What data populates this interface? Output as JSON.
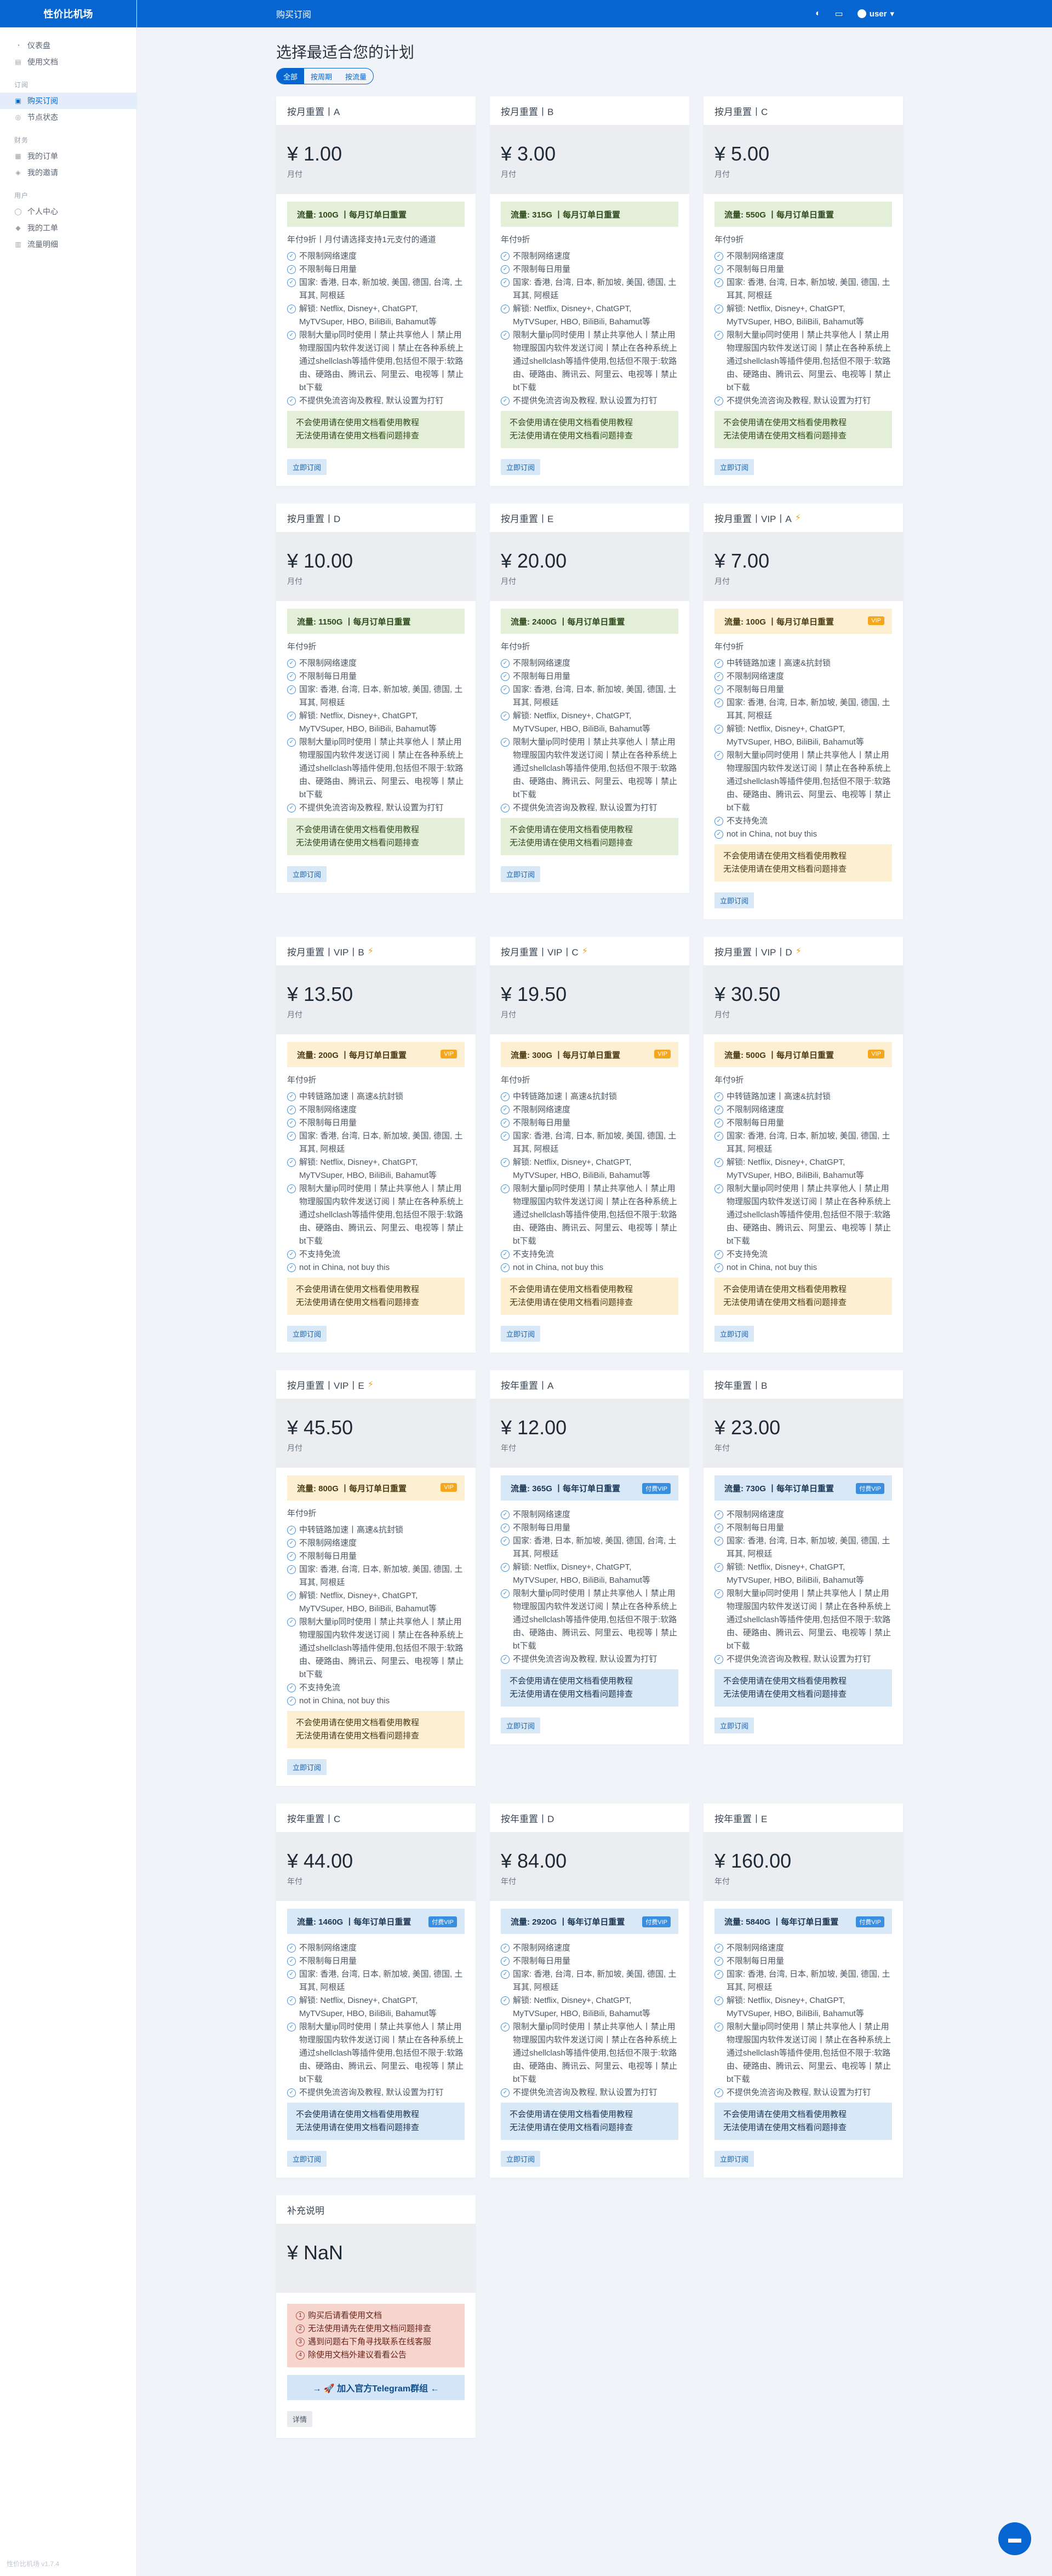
{
  "brand": "性价比机场",
  "sidebar": {
    "groups": [
      {
        "heading": "",
        "items": [
          {
            "icon": "dashboard-icon",
            "glyph": "◔",
            "label": "仪表盘"
          },
          {
            "icon": "docs-icon",
            "glyph": "▤",
            "label": "使用文档"
          }
        ]
      },
      {
        "heading": "订阅",
        "items": [
          {
            "icon": "cart-icon",
            "glyph": "▣",
            "label": "购买订阅",
            "active": true
          },
          {
            "icon": "node-icon",
            "glyph": "◎",
            "label": "节点状态"
          }
        ]
      },
      {
        "heading": "财务",
        "items": [
          {
            "icon": "order-icon",
            "glyph": "▦",
            "label": "我的订单"
          },
          {
            "icon": "invite-icon",
            "glyph": "◈",
            "label": "我的邀请"
          }
        ]
      },
      {
        "heading": "用户",
        "items": [
          {
            "icon": "user-icon",
            "glyph": "◯",
            "label": "个人中心"
          },
          {
            "icon": "ticket-icon",
            "glyph": "◆",
            "label": "我的工单"
          },
          {
            "icon": "traffic-icon",
            "glyph": "▥",
            "label": "流量明细"
          }
        ]
      }
    ],
    "footer": "性价比机场 v1.7.4"
  },
  "topbar": {
    "title": "购买订阅",
    "user": "user"
  },
  "page": {
    "title": "选择最适合您的计划",
    "tabs": [
      {
        "label": "全部",
        "active": true
      },
      {
        "label": "按周期",
        "active": false
      },
      {
        "label": "按流量",
        "active": false
      }
    ]
  },
  "labels": {
    "buy": "立即订阅",
    "vip_badge": "VIP",
    "year_badge": "付费VIP",
    "tg_button": "→ 🚀 加入官方Telegram群组 ←",
    "details_btn": "详情"
  },
  "plans": [
    {
      "title": "按月重置丨A",
      "price": "¥ 1.00",
      "period": "月付",
      "tone": "green",
      "banner": "流量: 100G 丨每月订单日重置",
      "badge": "",
      "bolt": false,
      "note": "年付9折丨月付请选择支持1元支付的通道",
      "features": [
        "不限制网络速度",
        "不限制每日用量",
        "国家: 香港, 日本, 新加坡, 美国, 德国, 台湾, 土耳其, 阿根廷",
        "解锁: Netflix, Disney+, ChatGPT, MyTVSuper, HBO, BiliBili, Bahamut等",
        "限制大量ip同时使用丨禁止共享他人丨禁止用物理服国内软件发送订阅丨禁止在各种系统上通过shellclash等插件使用,包括但不限于:软路由、硬路由、腾讯云、阿里云、电视等丨禁止bt下载",
        "不提供免流咨询及教程, 默认设置为打钉"
      ],
      "alert": [
        "不会使用请在使用文档看使用教程",
        "无法使用请在使用文档看问题排查"
      ]
    },
    {
      "title": "按月重置丨B",
      "price": "¥ 3.00",
      "period": "月付",
      "tone": "green",
      "banner": "流量: 315G 丨每月订单日重置",
      "badge": "",
      "bolt": false,
      "note": "年付9折",
      "features": [
        "不限制网络速度",
        "不限制每日用量",
        "国家: 香港, 台湾, 日本, 新加坡, 美国, 德国, 土耳其, 阿根廷",
        "解锁: Netflix, Disney+, ChatGPT, MyTVSuper, HBO, BiliBili, Bahamut等",
        "限制大量ip同时使用丨禁止共享他人丨禁止用物理服国内软件发送订阅丨禁止在各种系统上通过shellclash等插件使用,包括但不限于:软路由、硬路由、腾讯云、阿里云、电视等丨禁止bt下载",
        "不提供免流咨询及教程, 默认设置为打钉"
      ],
      "alert": [
        "不会使用请在使用文档看使用教程",
        "无法使用请在使用文档看问题排查"
      ]
    },
    {
      "title": "按月重置丨C",
      "price": "¥ 5.00",
      "period": "月付",
      "tone": "green",
      "banner": "流量: 550G 丨每月订单日重置",
      "badge": "",
      "bolt": false,
      "note": "年付9折",
      "features": [
        "不限制网络速度",
        "不限制每日用量",
        "国家: 香港, 台湾, 日本, 新加坡, 美国, 德国, 土耳其, 阿根廷",
        "解锁: Netflix, Disney+, ChatGPT, MyTVSuper, HBO, BiliBili, Bahamut等",
        "限制大量ip同时使用丨禁止共享他人丨禁止用物理服国内软件发送订阅丨禁止在各种系统上通过shellclash等插件使用,包括但不限于:软路由、硬路由、腾讯云、阿里云、电视等丨禁止bt下载",
        "不提供免流咨询及教程, 默认设置为打钉"
      ],
      "alert": [
        "不会使用请在使用文档看使用教程",
        "无法使用请在使用文档看问题排查"
      ]
    },
    {
      "title": "按月重置丨D",
      "price": "¥ 10.00",
      "period": "月付",
      "tone": "green",
      "banner": "流量: 1150G 丨每月订单日重置",
      "badge": "",
      "bolt": false,
      "note": "年付9折",
      "features": [
        "不限制网络速度",
        "不限制每日用量",
        "国家: 香港, 台湾, 日本, 新加坡, 美国, 德国, 土耳其, 阿根廷",
        "解锁: Netflix, Disney+, ChatGPT, MyTVSuper, HBO, BiliBili, Bahamut等",
        "限制大量ip同时使用丨禁止共享他人丨禁止用物理服国内软件发送订阅丨禁止在各种系统上通过shellclash等插件使用,包括但不限于:软路由、硬路由、腾讯云、阿里云、电视等丨禁止bt下载",
        "不提供免流咨询及教程, 默认设置为打钉"
      ],
      "alert": [
        "不会使用请在使用文档看使用教程",
        "无法使用请在使用文档看问题排查"
      ]
    },
    {
      "title": "按月重置丨E",
      "price": "¥ 20.00",
      "period": "月付",
      "tone": "green",
      "banner": "流量: 2400G 丨每月订单日重置",
      "badge": "",
      "bolt": false,
      "note": "年付9折",
      "features": [
        "不限制网络速度",
        "不限制每日用量",
        "国家: 香港, 台湾, 日本, 新加坡, 美国, 德国, 土耳其, 阿根廷",
        "解锁: Netflix, Disney+, ChatGPT, MyTVSuper, HBO, BiliBili, Bahamut等",
        "限制大量ip同时使用丨禁止共享他人丨禁止用物理服国内软件发送订阅丨禁止在各种系统上通过shellclash等插件使用,包括但不限于:软路由、硬路由、腾讯云、阿里云、电视等丨禁止bt下载",
        "不提供免流咨询及教程, 默认设置为打钉"
      ],
      "alert": [
        "不会使用请在使用文档看使用教程",
        "无法使用请在使用文档看问题排查"
      ]
    },
    {
      "title": "按月重置丨VIP丨A",
      "price": "¥ 7.00",
      "period": "月付",
      "tone": "yellow",
      "banner": "流量: 100G 丨每月订单日重置",
      "badge": "vip",
      "bolt": true,
      "note": "年付9折",
      "features": [
        "中转链路加速丨高速&抗封锁",
        "不限制网络速度",
        "不限制每日用量",
        "国家: 香港, 台湾, 日本, 新加坡, 美国, 德国, 土耳其, 阿根廷",
        "解锁: Netflix, Disney+, ChatGPT, MyTVSuper, HBO, BiliBili, Bahamut等",
        "限制大量ip同时使用丨禁止共享他人丨禁止用物理服国内软件发送订阅丨禁止在各种系统上通过shellclash等插件使用,包括但不限于:软路由、硬路由、腾讯云、阿里云、电视等丨禁止bt下载",
        "不支持免流",
        "not in China, not buy this"
      ],
      "alert": [
        "不会使用请在使用文档看使用教程",
        "无法使用请在使用文档看问题排查"
      ]
    },
    {
      "title": "按月重置丨VIP丨B",
      "price": "¥ 13.50",
      "period": "月付",
      "tone": "yellow",
      "banner": "流量: 200G 丨每月订单日重置",
      "badge": "vip",
      "bolt": true,
      "note": "年付9折",
      "features": [
        "中转链路加速丨高速&抗封锁",
        "不限制网络速度",
        "不限制每日用量",
        "国家: 香港, 台湾, 日本, 新加坡, 美国, 德国, 土耳其, 阿根廷",
        "解锁: Netflix, Disney+, ChatGPT, MyTVSuper, HBO, BiliBili, Bahamut等",
        "限制大量ip同时使用丨禁止共享他人丨禁止用物理服国内软件发送订阅丨禁止在各种系统上通过shellclash等插件使用,包括但不限于:软路由、硬路由、腾讯云、阿里云、电视等丨禁止bt下载",
        "不支持免流",
        "not in China, not buy this"
      ],
      "alert": [
        "不会使用请在使用文档看使用教程",
        "无法使用请在使用文档看问题排查"
      ]
    },
    {
      "title": "按月重置丨VIP丨C",
      "price": "¥ 19.50",
      "period": "月付",
      "tone": "yellow",
      "banner": "流量: 300G 丨每月订单日重置",
      "badge": "vip",
      "bolt": true,
      "note": "年付9折",
      "features": [
        "中转链路加速丨高速&抗封锁",
        "不限制网络速度",
        "不限制每日用量",
        "国家: 香港, 台湾, 日本, 新加坡, 美国, 德国, 土耳其, 阿根廷",
        "解锁: Netflix, Disney+, ChatGPT, MyTVSuper, HBO, BiliBili, Bahamut等",
        "限制大量ip同时使用丨禁止共享他人丨禁止用物理服国内软件发送订阅丨禁止在各种系统上通过shellclash等插件使用,包括但不限于:软路由、硬路由、腾讯云、阿里云、电视等丨禁止bt下载",
        "不支持免流",
        "not in China, not buy this"
      ],
      "alert": [
        "不会使用请在使用文档看使用教程",
        "无法使用请在使用文档看问题排查"
      ]
    },
    {
      "title": "按月重置丨VIP丨D",
      "price": "¥ 30.50",
      "period": "月付",
      "tone": "yellow",
      "banner": "流量: 500G 丨每月订单日重置",
      "badge": "vip",
      "bolt": true,
      "note": "年付9折",
      "features": [
        "中转链路加速丨高速&抗封锁",
        "不限制网络速度",
        "不限制每日用量",
        "国家: 香港, 台湾, 日本, 新加坡, 美国, 德国, 土耳其, 阿根廷",
        "解锁: Netflix, Disney+, ChatGPT, MyTVSuper, HBO, BiliBili, Bahamut等",
        "限制大量ip同时使用丨禁止共享他人丨禁止用物理服国内软件发送订阅丨禁止在各种系统上通过shellclash等插件使用,包括但不限于:软路由、硬路由、腾讯云、阿里云、电视等丨禁止bt下载",
        "不支持免流",
        "not in China, not buy this"
      ],
      "alert": [
        "不会使用请在使用文档看使用教程",
        "无法使用请在使用文档看问题排查"
      ]
    },
    {
      "title": "按月重置丨VIP丨E",
      "price": "¥ 45.50",
      "period": "月付",
      "tone": "yellow",
      "banner": "流量: 800G 丨每月订单日重置",
      "badge": "vip",
      "bolt": true,
      "note": "年付9折",
      "features": [
        "中转链路加速丨高速&抗封锁",
        "不限制网络速度",
        "不限制每日用量",
        "国家: 香港, 台湾, 日本, 新加坡, 美国, 德国, 土耳其, 阿根廷",
        "解锁: Netflix, Disney+, ChatGPT, MyTVSuper, HBO, BiliBili, Bahamut等",
        "限制大量ip同时使用丨禁止共享他人丨禁止用物理服国内软件发送订阅丨禁止在各种系统上通过shellclash等插件使用,包括但不限于:软路由、硬路由、腾讯云、阿里云、电视等丨禁止bt下载",
        "不支持免流",
        "not in China, not buy this"
      ],
      "alert": [
        "不会使用请在使用文档看使用教程",
        "无法使用请在使用文档看问题排查"
      ]
    },
    {
      "title": "按年重置丨A",
      "price": "¥ 12.00",
      "period": "年付",
      "tone": "blue",
      "banner": "流量: 365G 丨每年订单日重置",
      "badge": "year",
      "bolt": false,
      "note": "",
      "features": [
        "不限制网络速度",
        "不限制每日用量",
        "国家: 香港, 日本, 新加坡, 美国, 德国, 台湾, 土耳其, 阿根廷",
        "解锁: Netflix, Disney+, ChatGPT, MyTVSuper, HBO, BiliBili, Bahamut等",
        "限制大量ip同时使用丨禁止共享他人丨禁止用物理服国内软件发送订阅丨禁止在各种系统上通过shellclash等插件使用,包括但不限于:软路由、硬路由、腾讯云、阿里云、电视等丨禁止bt下载",
        "不提供免流咨询及教程, 默认设置为打钉"
      ],
      "alert": [
        "不会使用请在使用文档看使用教程",
        "无法使用请在使用文档看问题排查"
      ]
    },
    {
      "title": "按年重置丨B",
      "price": "¥ 23.00",
      "period": "年付",
      "tone": "blue",
      "banner": "流量: 730G 丨每年订单日重置",
      "badge": "year",
      "bolt": false,
      "note": "",
      "features": [
        "不限制网络速度",
        "不限制每日用量",
        "国家: 香港, 台湾, 日本, 新加坡, 美国, 德国, 土耳其, 阿根廷",
        "解锁: Netflix, Disney+, ChatGPT, MyTVSuper, HBO, BiliBili, Bahamut等",
        "限制大量ip同时使用丨禁止共享他人丨禁止用物理服国内软件发送订阅丨禁止在各种系统上通过shellclash等插件使用,包括但不限于:软路由、硬路由、腾讯云、阿里云、电视等丨禁止bt下载",
        "不提供免流咨询及教程, 默认设置为打钉"
      ],
      "alert": [
        "不会使用请在使用文档看使用教程",
        "无法使用请在使用文档看问题排查"
      ]
    },
    {
      "title": "按年重置丨C",
      "price": "¥ 44.00",
      "period": "年付",
      "tone": "blue",
      "banner": "流量: 1460G 丨每年订单日重置",
      "badge": "year",
      "bolt": false,
      "note": "",
      "features": [
        "不限制网络速度",
        "不限制每日用量",
        "国家: 香港, 台湾, 日本, 新加坡, 美国, 德国, 土耳其, 阿根廷",
        "解锁: Netflix, Disney+, ChatGPT, MyTVSuper, HBO, BiliBili, Bahamut等",
        "限制大量ip同时使用丨禁止共享他人丨禁止用物理服国内软件发送订阅丨禁止在各种系统上通过shellclash等插件使用,包括但不限于:软路由、硬路由、腾讯云、阿里云、电视等丨禁止bt下载",
        "不提供免流咨询及教程, 默认设置为打钉"
      ],
      "alert": [
        "不会使用请在使用文档看使用教程",
        "无法使用请在使用文档看问题排查"
      ]
    },
    {
      "title": "按年重置丨D",
      "price": "¥ 84.00",
      "period": "年付",
      "tone": "blue",
      "banner": "流量: 2920G 丨每年订单日重置",
      "badge": "year",
      "bolt": false,
      "note": "",
      "features": [
        "不限制网络速度",
        "不限制每日用量",
        "国家: 香港, 台湾, 日本, 新加坡, 美国, 德国, 土耳其, 阿根廷",
        "解锁: Netflix, Disney+, ChatGPT, MyTVSuper, HBO, BiliBili, Bahamut等",
        "限制大量ip同时使用丨禁止共享他人丨禁止用物理服国内软件发送订阅丨禁止在各种系统上通过shellclash等插件使用,包括但不限于:软路由、硬路由、腾讯云、阿里云、电视等丨禁止bt下载",
        "不提供免流咨询及教程, 默认设置为打钉"
      ],
      "alert": [
        "不会使用请在使用文档看使用教程",
        "无法使用请在使用文档看问题排查"
      ]
    },
    {
      "title": "按年重置丨E",
      "price": "¥ 160.00",
      "period": "年付",
      "tone": "blue",
      "banner": "流量: 5840G 丨每年订单日重置",
      "badge": "year",
      "bolt": false,
      "note": "",
      "features": [
        "不限制网络速度",
        "不限制每日用量",
        "国家: 香港, 台湾, 日本, 新加坡, 美国, 德国, 土耳其, 阿根廷",
        "解锁: Netflix, Disney+, ChatGPT, MyTVSuper, HBO, BiliBili, Bahamut等",
        "限制大量ip同时使用丨禁止共享他人丨禁止用物理服国内软件发送订阅丨禁止在各种系统上通过shellclash等插件使用,包括但不限于:软路由、硬路由、腾讯云、阿里云、电视等丨禁止bt下载",
        "不提供免流咨询及教程, 默认设置为打钉"
      ],
      "alert": [
        "不会使用请在使用文档看使用教程",
        "无法使用请在使用文档看问题排查"
      ]
    }
  ],
  "extra": {
    "title": "补充说明",
    "price": "¥ NaN",
    "lines": [
      {
        "num": "1",
        "text": "购买后请看使用文档"
      },
      {
        "num": "2",
        "text": "无法使用请先在使用文档问题排查"
      },
      {
        "num": "3",
        "text": "遇到问题右下角寻找联系在线客服"
      },
      {
        "num": "4",
        "text": "除使用文档外建议看看公告"
      }
    ]
  }
}
